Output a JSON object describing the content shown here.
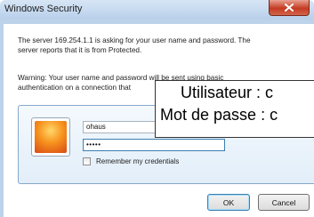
{
  "window": {
    "title": "Windows Security"
  },
  "message": {
    "line1": "The server 169.254.1.1 is asking for your user name and password. The\nserver reports that it is from Protected.",
    "warning": "Warning: Your user name and password will be sent using basic\nauthentication on a connection that"
  },
  "credentials": {
    "username_value": "ohaus",
    "password_value": "•••••",
    "remember_label": "Remember my credentials"
  },
  "buttons": {
    "ok_label": "OK",
    "cancel_label": "Cancel"
  },
  "overlay": {
    "line1": "Utilisateur : c",
    "line2": "Mot de passe : c"
  },
  "colors": {
    "close_button": "#c43b22",
    "accent": "#3c7fb1"
  },
  "icons": {
    "close": "close-icon",
    "user": "user-tile-icon"
  }
}
